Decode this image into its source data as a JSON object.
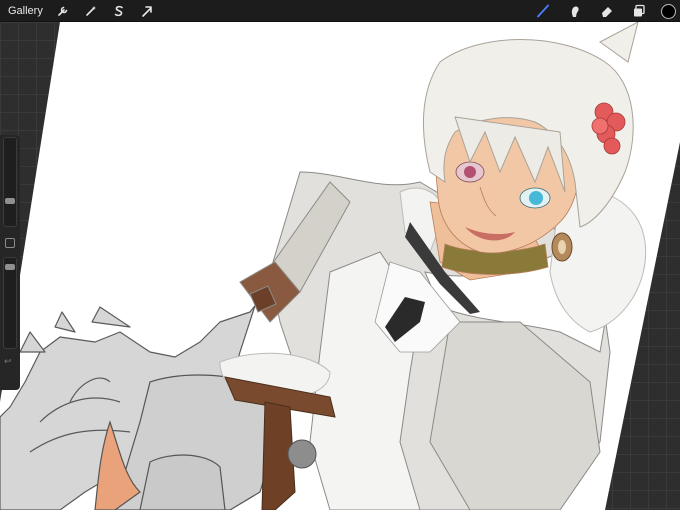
{
  "toolbar": {
    "gallery_label": "Gallery",
    "left_tools": [
      {
        "name": "actions-wrench-icon"
      },
      {
        "name": "adjustments-magic-wand-icon"
      },
      {
        "name": "selection-s-icon"
      },
      {
        "name": "transform-arrow-icon"
      }
    ],
    "right_tools": [
      {
        "name": "brush-icon",
        "active": true,
        "color": "#4a7dff"
      },
      {
        "name": "smudge-icon"
      },
      {
        "name": "eraser-icon"
      },
      {
        "name": "layers-icon"
      }
    ],
    "current_color": "#000000"
  },
  "sidebar": {
    "brush_size_level": 0.55,
    "opacity_level": 0.05
  },
  "colors": {
    "toolbar_bg": "#1c1c1c",
    "canvas_bg": "#ffffff",
    "workspace_bg": "#2e2e2e",
    "accent": "#4a7dff"
  }
}
